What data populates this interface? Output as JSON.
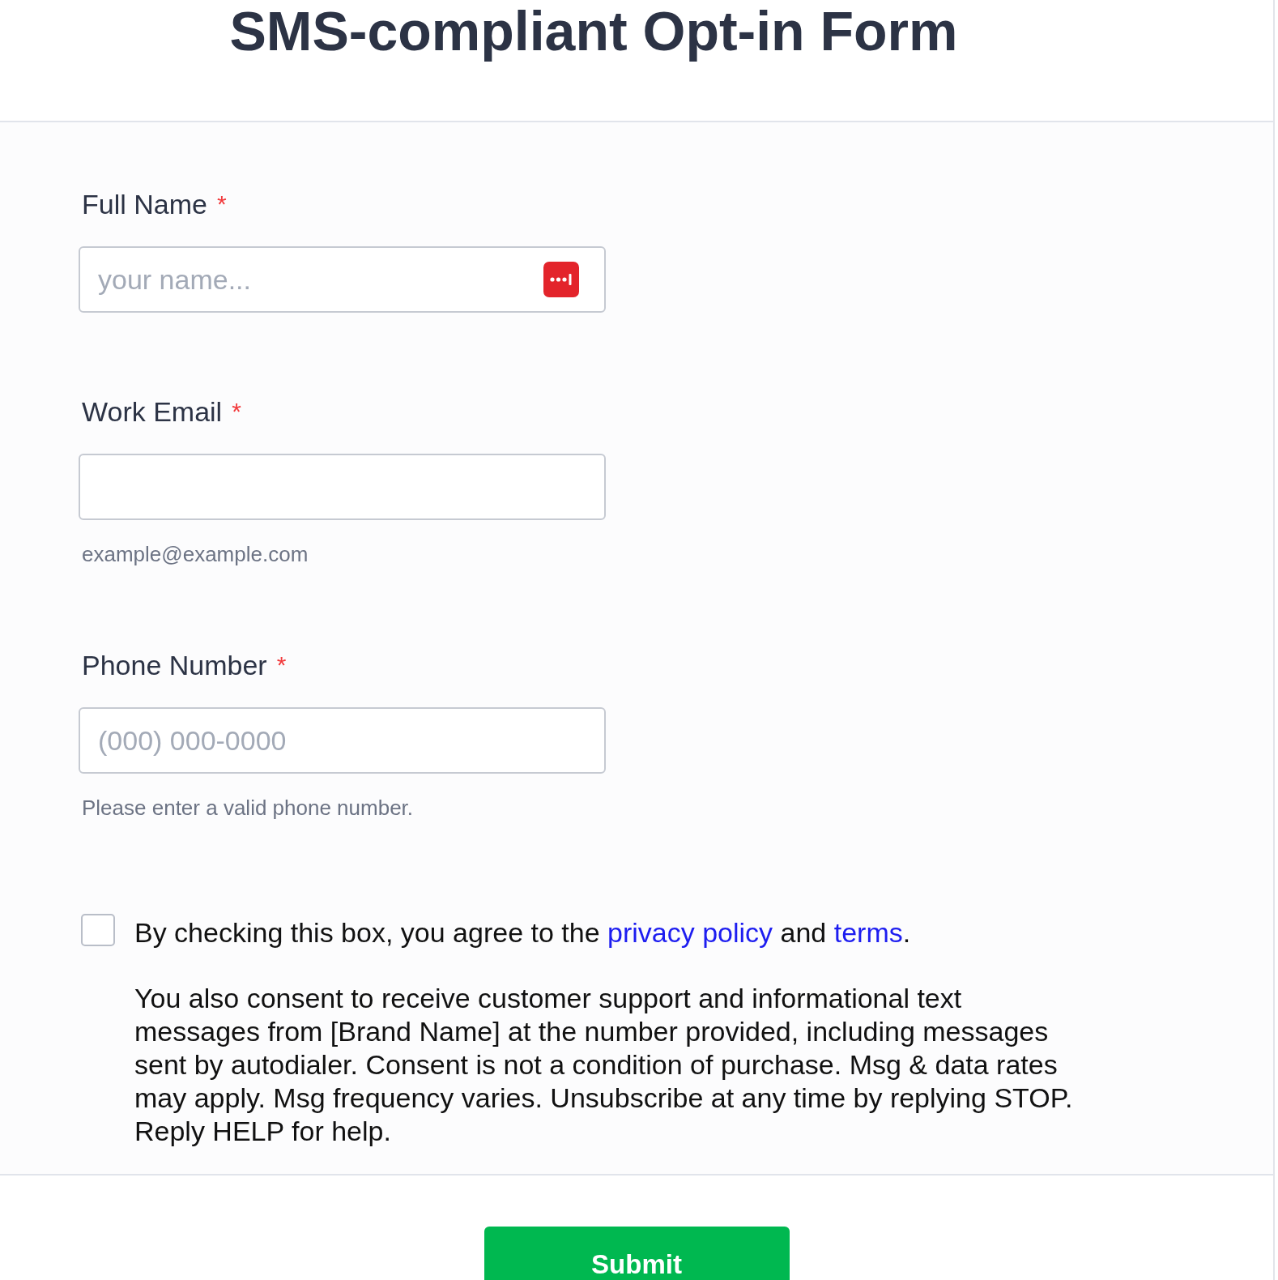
{
  "header": {
    "title": "SMS-compliant Opt-in Form"
  },
  "fields": [
    {
      "label": "Full Name",
      "marker": "*",
      "placeholder": "your name...",
      "badge": true
    },
    {
      "label": "Work Email",
      "marker": "*",
      "helper": "example@example.com",
      "badge": false
    },
    {
      "label": "Phone Number",
      "marker": "*",
      "placeholder": "(000) 000-0000",
      "helper": "Please enter a valid phone number.",
      "badge": false
    }
  ],
  "consent": {
    "checked": false,
    "statement": [
      {
        "kind": "text",
        "text": "By checking this box, you agree to the "
      },
      {
        "kind": "link",
        "text": "privacy policy"
      },
      {
        "kind": "text",
        "text": " and "
      },
      {
        "kind": "link",
        "text": "terms"
      },
      {
        "kind": "text",
        "text": "."
      }
    ],
    "disclosure": "You also consent to receive customer support and informational text messages from [Brand Name] at the number provided, including messages sent by autodialer. Consent is not a condition of purchase. Msg & data rates may apply. Msg frequency varies. Unsubscribe at any time by replying STOP. Reply HELP for help."
  },
  "submit": {
    "label": "Submit"
  }
}
